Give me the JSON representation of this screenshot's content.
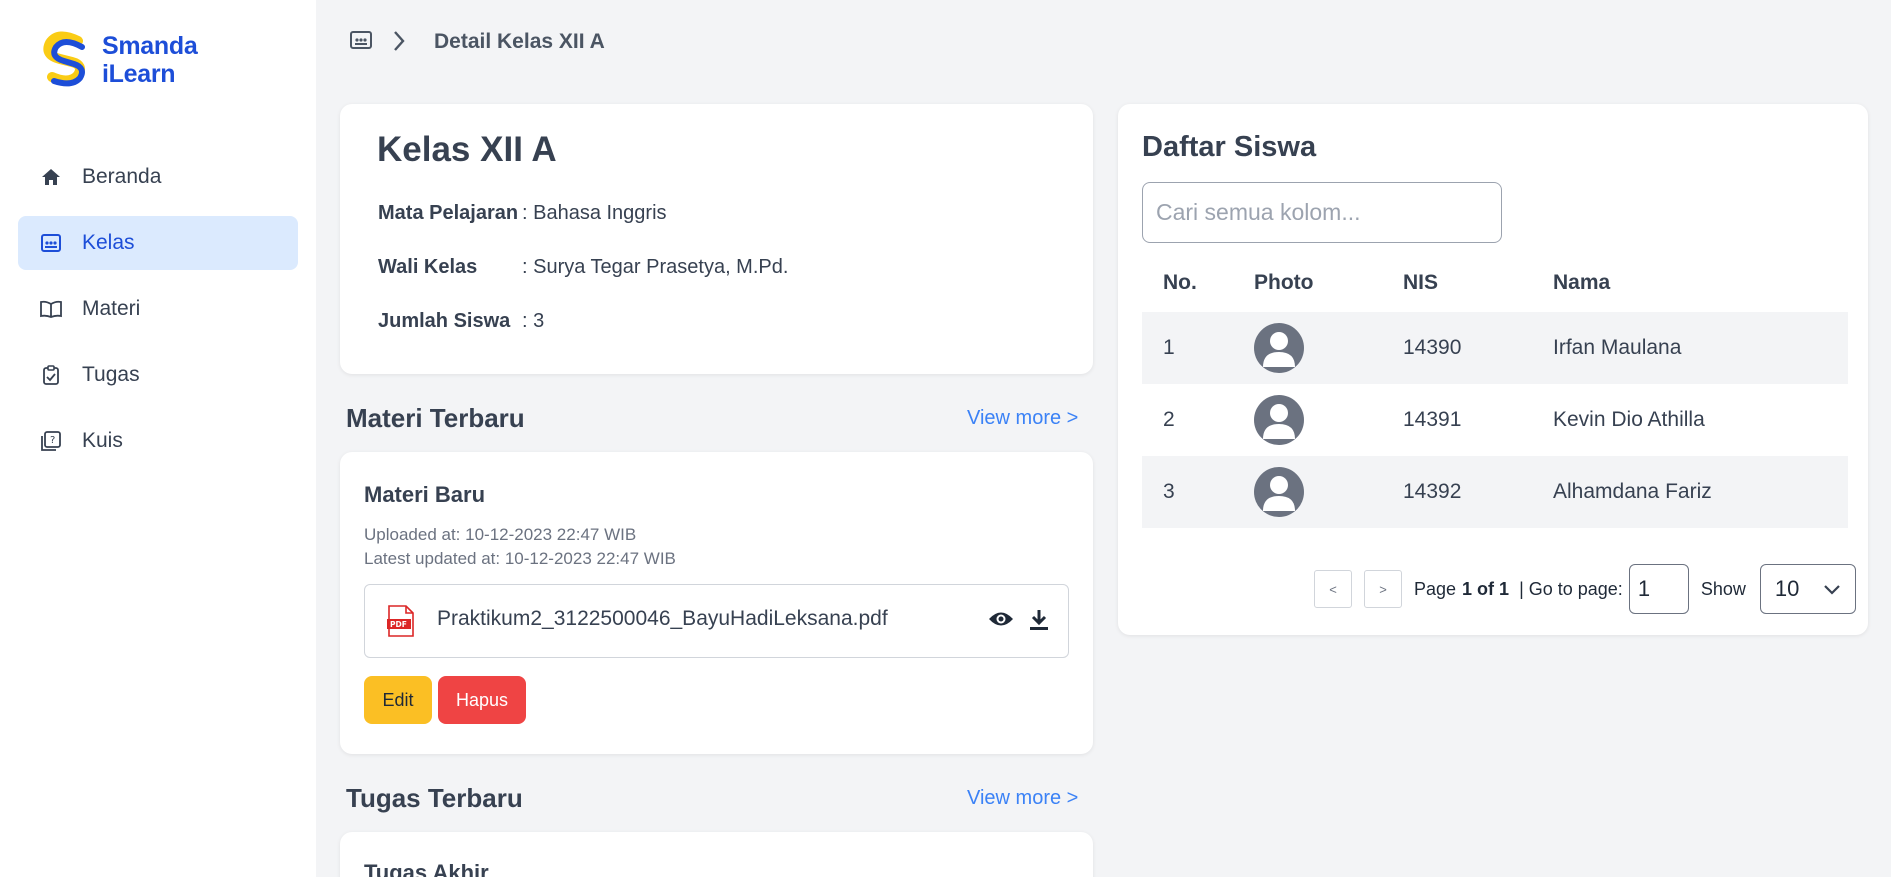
{
  "sidebar": {
    "logo_line1": "Smanda",
    "logo_line2": "iLearn",
    "items": [
      {
        "label": "Beranda",
        "icon": "home-icon"
      },
      {
        "label": "Kelas",
        "icon": "class-icon",
        "active": true
      },
      {
        "label": "Materi",
        "icon": "book-icon"
      },
      {
        "label": "Tugas",
        "icon": "clipboard-check-icon"
      },
      {
        "label": "Kuis",
        "icon": "quiz-icon"
      }
    ]
  },
  "breadcrumb": {
    "current": "Detail Kelas XII A"
  },
  "class_info": {
    "title": "Kelas XII A",
    "rows": [
      {
        "key": "Mata Pelajaran",
        "value": ": Bahasa Inggris"
      },
      {
        "key": "Wali Kelas",
        "value": ": Surya Tegar Prasetya, M.Pd."
      },
      {
        "key": "Jumlah Siswa",
        "value": ": 3"
      }
    ]
  },
  "materi": {
    "section_title": "Materi Terbaru",
    "view_more": "View more >",
    "item_title": "Materi Baru",
    "uploaded": "Uploaded at: 10-12-2023 22:47 WIB",
    "updated": "Latest updated at: 10-12-2023 22:47 WIB",
    "file_name": "Praktikum2_3122500046_BayuHadiLeksana.pdf",
    "edit_label": "Edit",
    "delete_label": "Hapus"
  },
  "tugas": {
    "section_title": "Tugas Terbaru",
    "view_more": "View more >",
    "item_title": "Tugas Akhir"
  },
  "siswa": {
    "title": "Daftar Siswa",
    "search_placeholder": "Cari semua kolom...",
    "columns": [
      "No.",
      "Photo",
      "NIS",
      "Nama"
    ],
    "rows": [
      {
        "no": "1",
        "nis": "14390",
        "nama": "Irfan Maulana"
      },
      {
        "no": "2",
        "nis": "14391",
        "nama": "Kevin Dio Athilla"
      },
      {
        "no": "3",
        "nis": "14392",
        "nama": "Alhamdana Fariz"
      }
    ],
    "pager": {
      "prev": "<",
      "next": ">",
      "page_prefix": "Page",
      "page_value": "1 of 1",
      "goto_label": "| Go to page:",
      "goto_value": "1",
      "show_label": "Show",
      "show_value": "10"
    }
  },
  "colors": {
    "accent": "#1d4ed8",
    "active_bg": "#dbeafe",
    "edit": "#fbbf24",
    "delete": "#ef4444",
    "link": "#3b82f6"
  }
}
